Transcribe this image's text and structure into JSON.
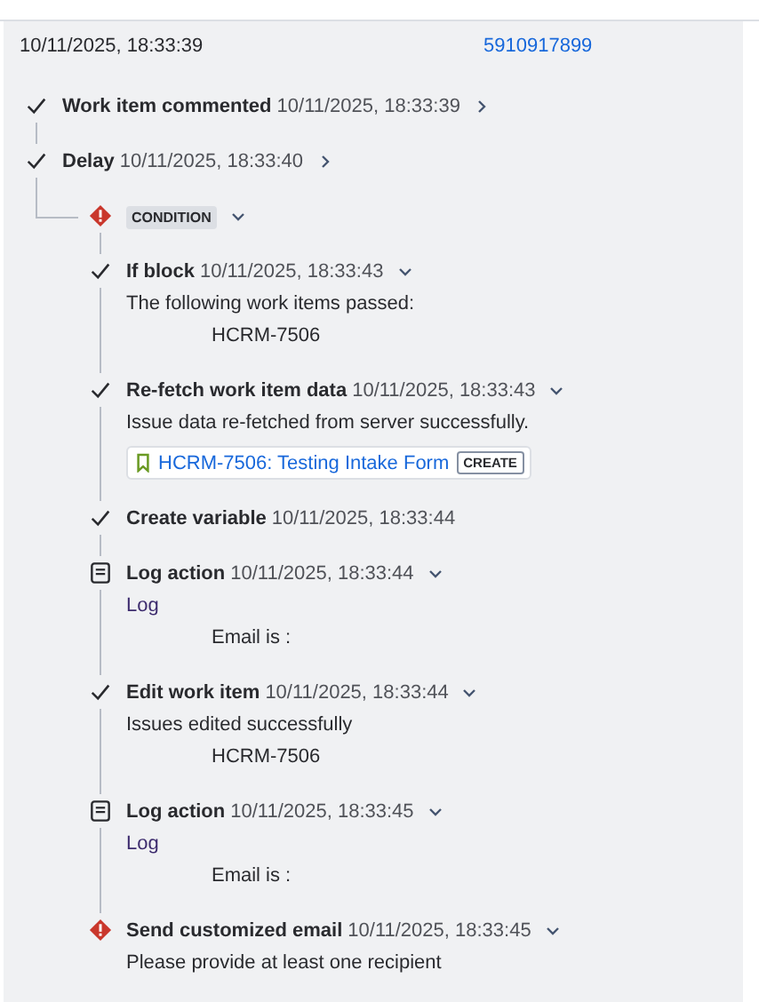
{
  "entry": {
    "date_time": "10/11/2025, 18:33:39",
    "audit_log_id": "5910917899"
  },
  "steps": [
    {
      "kind": "success",
      "title": "Work item commented",
      "time": "10/11/2025, 18:33:39",
      "expanded": false
    },
    {
      "kind": "success",
      "title": "Delay",
      "time": "10/11/2025, 18:33:40",
      "expanded": false
    }
  ],
  "condition": {
    "kind": "error",
    "label": "CONDITION",
    "expanded": true,
    "steps": [
      {
        "kind": "success",
        "title": "If block",
        "time": "10/11/2025, 18:33:43",
        "expanded": true,
        "details": [
          {
            "kind": "text",
            "text": "The following work items passed:"
          },
          {
            "kind": "indented",
            "text": "HCRM-7506"
          }
        ]
      },
      {
        "kind": "success",
        "title": "Re-fetch work item data",
        "time": "10/11/2025, 18:33:43",
        "expanded": true,
        "details": [
          {
            "kind": "text",
            "text": "Issue data re-fetched from server successfully."
          },
          {
            "kind": "link",
            "text": "HCRM-7506: Testing Intake Form",
            "badge": "CREATE"
          }
        ]
      },
      {
        "kind": "success",
        "title": "Create variable",
        "time": "10/11/2025, 18:33:44"
      },
      {
        "kind": "log",
        "title": "Log action",
        "time": "10/11/2025, 18:33:44",
        "expanded": true,
        "details": [
          {
            "kind": "log",
            "text": "Log"
          },
          {
            "kind": "indented",
            "text": "Email is :"
          }
        ]
      },
      {
        "kind": "success",
        "title": "Edit work item",
        "time": "10/11/2025, 18:33:44",
        "expanded": true,
        "details": [
          {
            "kind": "text",
            "text": "Issues edited successfully"
          },
          {
            "kind": "indented",
            "text": "HCRM-7506"
          }
        ]
      },
      {
        "kind": "log",
        "title": "Log action",
        "time": "10/11/2025, 18:33:45",
        "expanded": true,
        "details": [
          {
            "kind": "log",
            "text": "Log"
          },
          {
            "kind": "indented",
            "text": "Email is :"
          }
        ]
      },
      {
        "kind": "error",
        "title": "Send customized email",
        "time": "10/11/2025, 18:33:45",
        "expanded": true,
        "details": [
          {
            "kind": "text",
            "text": "Please provide at least one recipient"
          }
        ]
      }
    ]
  }
}
